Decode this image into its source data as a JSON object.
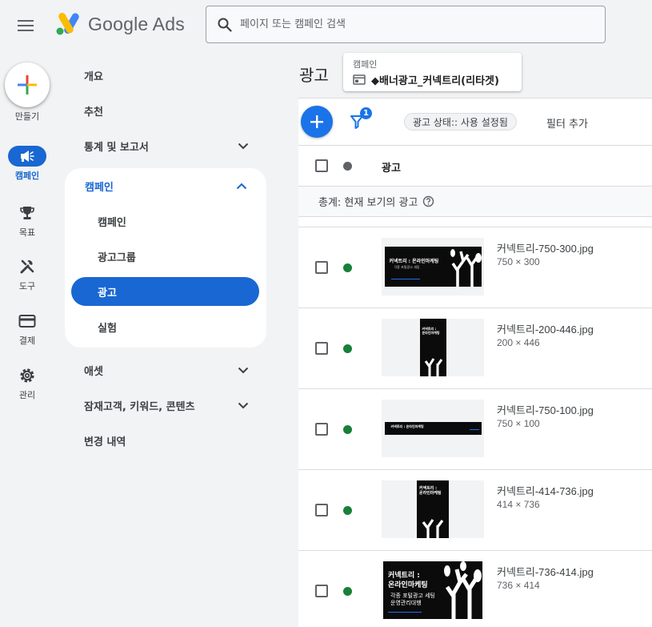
{
  "app": {
    "name": "Google Ads",
    "search_placeholder": "페이지 또는 캠페인 검색"
  },
  "rail": {
    "create_label": "만들기",
    "items": [
      {
        "label": "캠페인",
        "icon": "megaphone-icon",
        "active": true
      },
      {
        "label": "목표",
        "icon": "trophy-icon"
      },
      {
        "label": "도구",
        "icon": "tools-icon"
      },
      {
        "label": "결제",
        "icon": "credit-card-icon"
      },
      {
        "label": "관리",
        "icon": "gear-icon"
      }
    ]
  },
  "nav": {
    "items": [
      {
        "label": "개요"
      },
      {
        "label": "추천"
      },
      {
        "label": "통계 및 보고서",
        "expandable": true
      }
    ],
    "campaign_group": {
      "label": "캠페인",
      "expanded": true,
      "children": [
        {
          "label": "캠페인"
        },
        {
          "label": "광고그룹"
        },
        {
          "label": "광고",
          "active": true
        },
        {
          "label": "실험"
        }
      ]
    },
    "items_after": [
      {
        "label": "애셋",
        "expandable": true
      },
      {
        "label": "잠재고객, 키워드, 콘텐츠",
        "expandable": true
      },
      {
        "label": "변경 내역"
      }
    ]
  },
  "main": {
    "title": "광고",
    "campaign_chip": {
      "label": "캠페인",
      "value": "◆배너광고_커넥트리(리타겟)"
    },
    "toolbar": {
      "filter_count": "1",
      "status_filter": "광고 상태:: 사용 설정됨",
      "add_filter": "필터 추가"
    },
    "table": {
      "column_header": "광고",
      "total_label": "총계: 현재 보기의 광고",
      "rows": [
        {
          "name": "커넥트리-750-300.jpg",
          "size": "750 × 300",
          "status": "enabled"
        },
        {
          "name": "커넥트리-200-446.jpg",
          "size": "200 × 446",
          "status": "enabled"
        },
        {
          "name": "커넥트리-750-100.jpg",
          "size": "750 × 100",
          "status": "enabled"
        },
        {
          "name": "커넥트리-414-736.jpg",
          "size": "414 × 736",
          "status": "enabled"
        },
        {
          "name": "커넥트리-736-414.jpg",
          "size": "736 × 414",
          "status": "enabled"
        }
      ]
    },
    "banner_text": {
      "headline": "커넥트리 : 온라인마케팅",
      "headline_line1": "커넥트리 :",
      "headline_line2": "온라인마케팅",
      "sub_line1": "각종 포털광고 세팅",
      "sub_line2": "운영관리대행"
    }
  },
  "colors": {
    "accent": "#1967d2",
    "fab": "#1a73e8",
    "status_enabled": "#188038",
    "background": "#f1f3f4"
  }
}
